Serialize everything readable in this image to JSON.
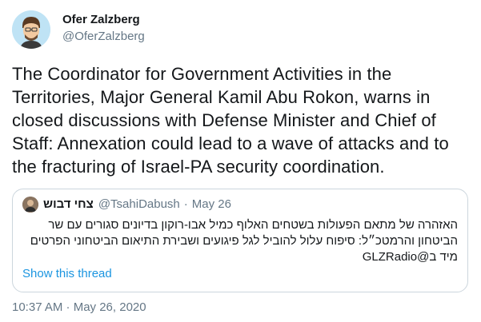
{
  "author": {
    "name": "Ofer Zalzberg",
    "handle": "@OferZalzberg"
  },
  "tweet": {
    "text": "The Coordinator for Government Activities in the Territories, Major General Kamil Abu Rokon, warns in closed discussions with Defense Minister and Chief of Staff: Annexation could lead to a wave of attacks and to the fracturing of Israel-PA security coordination.",
    "timestamp": "10:37 AM · May 26, 2020"
  },
  "quote": {
    "name": "צחי דבוש",
    "handle": "@TsahiDabush",
    "separator": "·",
    "date": "May 26",
    "text": "האזהרה של מתאם הפעולות בשטחים האלוף כמיל אבו-רוקון בדיונים סגורים עם שר הביטחון והרמטכ״ל: סיפוח עלול להוביל לגל פיגועים ושבירת התיאום הביטחוני הפרטים מיד ב@GLZRadio",
    "show_thread": "Show this thread"
  },
  "icons": {
    "avatar": "cartoon-avatar-icon",
    "quote_avatar": "user-photo-icon"
  },
  "colors": {
    "link": "#1b95e0",
    "secondary_text": "#657786",
    "border": "#ccd6dd"
  }
}
